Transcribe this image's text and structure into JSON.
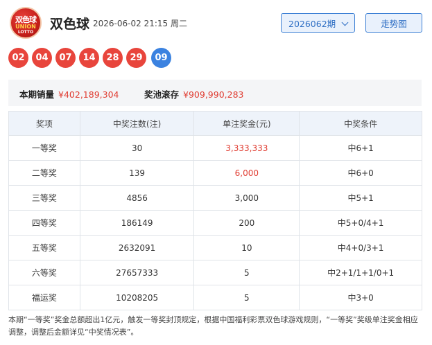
{
  "header": {
    "logo": {
      "text": "双色球",
      "sub": "UNION",
      "sub2": "LOTTO"
    },
    "title": "双色球",
    "draw_date": "2026-06-02 21:15 周二",
    "period_select": "2026062期",
    "trend_button": "走势图"
  },
  "balls": {
    "red": [
      "02",
      "04",
      "07",
      "14",
      "28",
      "29"
    ],
    "blue": [
      "09"
    ],
    "colors": {
      "red": "#e8453c",
      "blue": "#3b82e0"
    }
  },
  "summary": {
    "sales_label": "本期销量",
    "sales_value": "¥402,189,304",
    "pool_label": "奖池滚存",
    "pool_value": "¥909,990,283"
  },
  "table": {
    "headers": [
      "奖项",
      "中奖注数(注)",
      "单注奖金(元)",
      "中奖条件"
    ],
    "rows": [
      {
        "prize": "一等奖",
        "count": "30",
        "amount": "3,333,333",
        "condition": "中6+1"
      },
      {
        "prize": "二等奖",
        "count": "139",
        "amount": "6,000",
        "condition": "中6+0"
      },
      {
        "prize": "三等奖",
        "count": "4856",
        "amount": "3,000",
        "condition": "中5+1"
      },
      {
        "prize": "四等奖",
        "count": "186149",
        "amount": "200",
        "condition": "中5+0/4+1"
      },
      {
        "prize": "五等奖",
        "count": "2632091",
        "amount": "10",
        "condition": "中4+0/3+1"
      },
      {
        "prize": "六等奖",
        "count": "27657333",
        "amount": "5",
        "condition": "中2+1/1+1/0+1"
      },
      {
        "prize": "福运奖",
        "count": "10208205",
        "amount": "5",
        "condition": "中3+0"
      }
    ]
  },
  "footnote": "本期“一等奖”奖金总额超出1亿元，触发一等奖封顶规定，根据中国福利彩票双色球游戏规则，“一等奖”奖级单注奖金相应调整，调整后金额详见“中奖情况表”。",
  "accent": "#3b7fd4",
  "highlight": "#e03c31"
}
